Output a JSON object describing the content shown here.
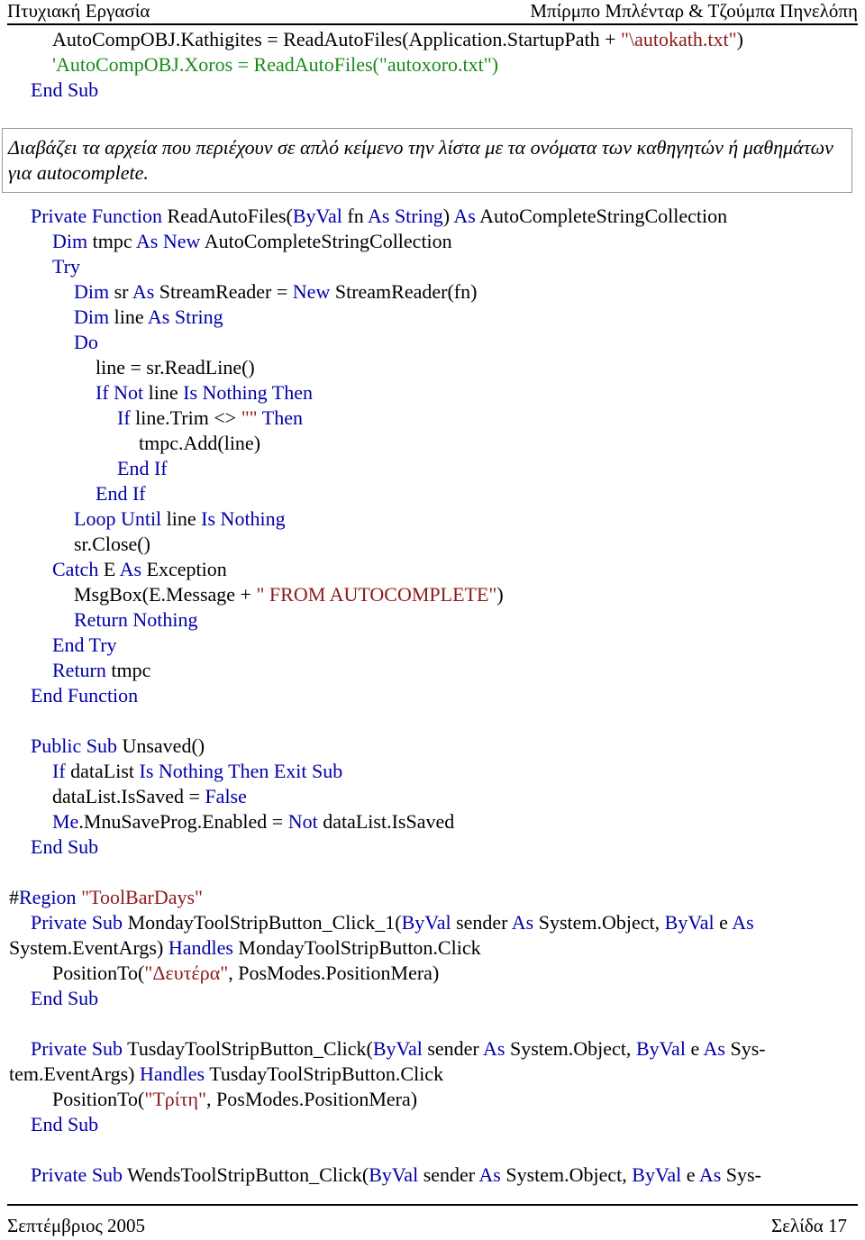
{
  "header": {
    "left": "Πτυχιακή Εργασία",
    "right": "Μπίρμπο Μπλένταρ & Τζούμπα Πηνελόπη"
  },
  "note": "Διαβάζει τα αρχεία που περιέχουν σε απλό κείμενο την λίστα με τα ονόματα των καθηγητών ή μαθημάτων για autocomplete.",
  "footer": {
    "left": "Σεπτέμβριος 2005",
    "right": "Σελίδα 17"
  },
  "colors": {
    "keyword": "#0000a8",
    "string": "#8b1a1a",
    "comment": "#1a8a1a"
  },
  "code_top": [
    {
      "indent": 2,
      "tokens": [
        [
          "p",
          "AutoCompOBJ.Kathigites = ReadAutoFiles(Application.StartupPath + "
        ],
        [
          "s",
          "\"\\autokath.txt\""
        ],
        [
          "p",
          ")"
        ]
      ]
    },
    {
      "indent": 2,
      "tokens": [
        [
          "c",
          "'AutoCompOBJ.Xoros = ReadAutoFiles(\"autoxoro.txt\")"
        ]
      ]
    },
    {
      "indent": 1,
      "tokens": [
        [
          "k",
          "End Sub"
        ]
      ]
    }
  ],
  "code_main": [
    {
      "indent": 1,
      "tokens": [
        [
          "k",
          "Private Function "
        ],
        [
          "p",
          "ReadAutoFiles("
        ],
        [
          "k",
          "ByVal "
        ],
        [
          "p",
          "fn "
        ],
        [
          "k",
          "As String"
        ],
        [
          "p",
          ") "
        ],
        [
          "k",
          "As "
        ],
        [
          "p",
          "AutoCompleteStringCollection"
        ]
      ]
    },
    {
      "indent": 2,
      "tokens": [
        [
          "k",
          "Dim "
        ],
        [
          "p",
          "tmpc "
        ],
        [
          "k",
          "As New "
        ],
        [
          "p",
          "AutoCompleteStringCollection"
        ]
      ]
    },
    {
      "indent": 2,
      "tokens": [
        [
          "k",
          "Try"
        ]
      ]
    },
    {
      "indent": 3,
      "tokens": [
        [
          "k",
          "Dim "
        ],
        [
          "p",
          "sr "
        ],
        [
          "k",
          "As "
        ],
        [
          "p",
          "StreamReader = "
        ],
        [
          "k",
          "New "
        ],
        [
          "p",
          "StreamReader(fn)"
        ]
      ]
    },
    {
      "indent": 3,
      "tokens": [
        [
          "k",
          "Dim "
        ],
        [
          "p",
          "line "
        ],
        [
          "k",
          "As String"
        ]
      ]
    },
    {
      "indent": 3,
      "tokens": [
        [
          "k",
          "Do"
        ]
      ]
    },
    {
      "indent": 4,
      "tokens": [
        [
          "p",
          "line = sr.ReadLine()"
        ]
      ]
    },
    {
      "indent": 4,
      "tokens": [
        [
          "k",
          "If Not "
        ],
        [
          "p",
          "line "
        ],
        [
          "k",
          "Is Nothing Then"
        ]
      ]
    },
    {
      "indent": 5,
      "tokens": [
        [
          "k",
          "If "
        ],
        [
          "p",
          "line.Trim <> "
        ],
        [
          "s",
          "\"\""
        ],
        [
          "k",
          " Then"
        ]
      ]
    },
    {
      "indent": 6,
      "tokens": [
        [
          "p",
          "tmpc.Add(line)"
        ]
      ]
    },
    {
      "indent": 5,
      "tokens": [
        [
          "k",
          "End If"
        ]
      ]
    },
    {
      "indent": 4,
      "tokens": [
        [
          "k",
          "End If"
        ]
      ]
    },
    {
      "indent": 3,
      "tokens": [
        [
          "k",
          "Loop Until "
        ],
        [
          "p",
          "line "
        ],
        [
          "k",
          "Is Nothing"
        ]
      ]
    },
    {
      "indent": 3,
      "tokens": [
        [
          "p",
          "sr.Close()"
        ]
      ]
    },
    {
      "indent": 2,
      "tokens": [
        [
          "k",
          "Catch "
        ],
        [
          "p",
          "E "
        ],
        [
          "k",
          "As "
        ],
        [
          "p",
          "Exception"
        ]
      ]
    },
    {
      "indent": 3,
      "tokens": [
        [
          "p",
          "MsgBox(E.Message + "
        ],
        [
          "s",
          "\" FROM AUTOCOMPLETE\""
        ],
        [
          "p",
          ")"
        ]
      ]
    },
    {
      "indent": 3,
      "tokens": [
        [
          "k",
          "Return Nothing"
        ]
      ]
    },
    {
      "indent": 2,
      "tokens": [
        [
          "k",
          "End Try"
        ]
      ]
    },
    {
      "indent": 2,
      "tokens": [
        [
          "k",
          "Return "
        ],
        [
          "p",
          "tmpc"
        ]
      ]
    },
    {
      "indent": 1,
      "tokens": [
        [
          "k",
          "End Function"
        ]
      ]
    },
    {
      "indent": 0,
      "tokens": []
    },
    {
      "indent": 1,
      "tokens": [
        [
          "k",
          "Public Sub "
        ],
        [
          "p",
          "Unsaved()"
        ]
      ]
    },
    {
      "indent": 2,
      "tokens": [
        [
          "k",
          "If "
        ],
        [
          "p",
          "dataList "
        ],
        [
          "k",
          "Is Nothing Then Exit Sub"
        ]
      ]
    },
    {
      "indent": 2,
      "tokens": [
        [
          "p",
          "dataList.IsSaved = "
        ],
        [
          "k",
          "False"
        ]
      ]
    },
    {
      "indent": 2,
      "tokens": [
        [
          "k",
          "Me"
        ],
        [
          "p",
          ".MnuSaveProg.Enabled = "
        ],
        [
          "k",
          "Not "
        ],
        [
          "p",
          "dataList.IsSaved"
        ]
      ]
    },
    {
      "indent": 1,
      "tokens": [
        [
          "k",
          "End Sub"
        ]
      ]
    },
    {
      "indent": 0,
      "tokens": []
    },
    {
      "indent": 0,
      "tokens": [
        [
          "p",
          "#"
        ],
        [
          "k",
          "Region "
        ],
        [
          "s",
          "\"ToolBarDays\""
        ]
      ]
    },
    {
      "indent": 1,
      "tokens": [
        [
          "k",
          "Private Sub "
        ],
        [
          "p",
          "MondayToolStripButton_Click_1("
        ],
        [
          "k",
          "ByVal "
        ],
        [
          "p",
          "sender "
        ],
        [
          "k",
          "As "
        ],
        [
          "p",
          "System.Object, "
        ],
        [
          "k",
          "ByVal "
        ],
        [
          "p",
          "e "
        ],
        [
          "k",
          "As"
        ]
      ]
    },
    {
      "indent": 0,
      "tokens": [
        [
          "p",
          "System.EventArgs) "
        ],
        [
          "k",
          "Handles "
        ],
        [
          "p",
          "MondayToolStripButton.Click"
        ]
      ]
    },
    {
      "indent": 2,
      "tokens": [
        [
          "p",
          "PositionTo("
        ],
        [
          "s",
          "\"Δευτέρα\""
        ],
        [
          "p",
          ", PosModes.PositionMera)"
        ]
      ]
    },
    {
      "indent": 1,
      "tokens": [
        [
          "k",
          "End Sub"
        ]
      ]
    },
    {
      "indent": 0,
      "tokens": []
    },
    {
      "indent": 1,
      "tokens": [
        [
          "k",
          "Private Sub "
        ],
        [
          "p",
          "TusdayToolStripButton_Click("
        ],
        [
          "k",
          "ByVal "
        ],
        [
          "p",
          "sender "
        ],
        [
          "k",
          "As "
        ],
        [
          "p",
          "System.Object, "
        ],
        [
          "k",
          "ByVal "
        ],
        [
          "p",
          "e "
        ],
        [
          "k",
          "As "
        ],
        [
          "p",
          "Sys-"
        ]
      ]
    },
    {
      "indent": 0,
      "tokens": [
        [
          "p",
          "tem.EventArgs) "
        ],
        [
          "k",
          "Handles "
        ],
        [
          "p",
          "TusdayToolStripButton.Click"
        ]
      ]
    },
    {
      "indent": 2,
      "tokens": [
        [
          "p",
          "PositionTo("
        ],
        [
          "s",
          "\"Τρίτη\""
        ],
        [
          "p",
          ", PosModes.PositionMera)"
        ]
      ]
    },
    {
      "indent": 1,
      "tokens": [
        [
          "k",
          "End Sub"
        ]
      ]
    },
    {
      "indent": 0,
      "tokens": []
    },
    {
      "indent": 1,
      "tokens": [
        [
          "k",
          "Private Sub "
        ],
        [
          "p",
          "WendsToolStripButton_Click("
        ],
        [
          "k",
          "ByVal "
        ],
        [
          "p",
          "sender "
        ],
        [
          "k",
          "As "
        ],
        [
          "p",
          "System.Object, "
        ],
        [
          "k",
          "ByVal "
        ],
        [
          "p",
          "e "
        ],
        [
          "k",
          "As "
        ],
        [
          "p",
          "Sys-"
        ]
      ]
    }
  ]
}
